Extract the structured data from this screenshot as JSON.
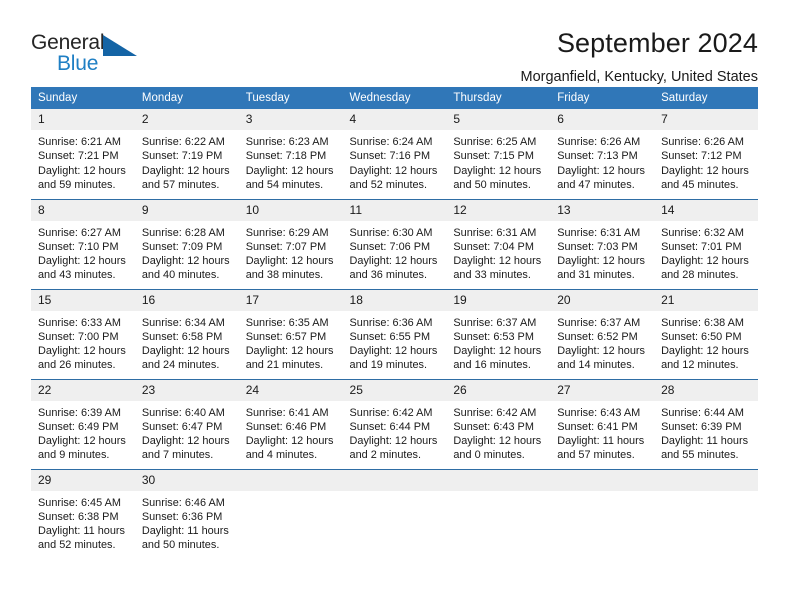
{
  "logo": {
    "line1": "General",
    "line2": "Blue",
    "triangle_color": "#1464a5",
    "blue_text_color": "#1f7fc4"
  },
  "header": {
    "title": "September 2024",
    "subtitle": "Morganfield, Kentucky, United States"
  },
  "theme": {
    "header_band": "#3077b8",
    "row_rule": "#2e6da4",
    "daynum_band": "#efefef"
  },
  "weekday_headers": [
    "Sunday",
    "Monday",
    "Tuesday",
    "Wednesday",
    "Thursday",
    "Friday",
    "Saturday"
  ],
  "weeks": [
    [
      {
        "day": "1",
        "sunrise": "Sunrise: 6:21 AM",
        "sunset": "Sunset: 7:21 PM",
        "daylight1": "Daylight: 12 hours",
        "daylight2": "and 59 minutes."
      },
      {
        "day": "2",
        "sunrise": "Sunrise: 6:22 AM",
        "sunset": "Sunset: 7:19 PM",
        "daylight1": "Daylight: 12 hours",
        "daylight2": "and 57 minutes."
      },
      {
        "day": "3",
        "sunrise": "Sunrise: 6:23 AM",
        "sunset": "Sunset: 7:18 PM",
        "daylight1": "Daylight: 12 hours",
        "daylight2": "and 54 minutes."
      },
      {
        "day": "4",
        "sunrise": "Sunrise: 6:24 AM",
        "sunset": "Sunset: 7:16 PM",
        "daylight1": "Daylight: 12 hours",
        "daylight2": "and 52 minutes."
      },
      {
        "day": "5",
        "sunrise": "Sunrise: 6:25 AM",
        "sunset": "Sunset: 7:15 PM",
        "daylight1": "Daylight: 12 hours",
        "daylight2": "and 50 minutes."
      },
      {
        "day": "6",
        "sunrise": "Sunrise: 6:26 AM",
        "sunset": "Sunset: 7:13 PM",
        "daylight1": "Daylight: 12 hours",
        "daylight2": "and 47 minutes."
      },
      {
        "day": "7",
        "sunrise": "Sunrise: 6:26 AM",
        "sunset": "Sunset: 7:12 PM",
        "daylight1": "Daylight: 12 hours",
        "daylight2": "and 45 minutes."
      }
    ],
    [
      {
        "day": "8",
        "sunrise": "Sunrise: 6:27 AM",
        "sunset": "Sunset: 7:10 PM",
        "daylight1": "Daylight: 12 hours",
        "daylight2": "and 43 minutes."
      },
      {
        "day": "9",
        "sunrise": "Sunrise: 6:28 AM",
        "sunset": "Sunset: 7:09 PM",
        "daylight1": "Daylight: 12 hours",
        "daylight2": "and 40 minutes."
      },
      {
        "day": "10",
        "sunrise": "Sunrise: 6:29 AM",
        "sunset": "Sunset: 7:07 PM",
        "daylight1": "Daylight: 12 hours",
        "daylight2": "and 38 minutes."
      },
      {
        "day": "11",
        "sunrise": "Sunrise: 6:30 AM",
        "sunset": "Sunset: 7:06 PM",
        "daylight1": "Daylight: 12 hours",
        "daylight2": "and 36 minutes."
      },
      {
        "day": "12",
        "sunrise": "Sunrise: 6:31 AM",
        "sunset": "Sunset: 7:04 PM",
        "daylight1": "Daylight: 12 hours",
        "daylight2": "and 33 minutes."
      },
      {
        "day": "13",
        "sunrise": "Sunrise: 6:31 AM",
        "sunset": "Sunset: 7:03 PM",
        "daylight1": "Daylight: 12 hours",
        "daylight2": "and 31 minutes."
      },
      {
        "day": "14",
        "sunrise": "Sunrise: 6:32 AM",
        "sunset": "Sunset: 7:01 PM",
        "daylight1": "Daylight: 12 hours",
        "daylight2": "and 28 minutes."
      }
    ],
    [
      {
        "day": "15",
        "sunrise": "Sunrise: 6:33 AM",
        "sunset": "Sunset: 7:00 PM",
        "daylight1": "Daylight: 12 hours",
        "daylight2": "and 26 minutes."
      },
      {
        "day": "16",
        "sunrise": "Sunrise: 6:34 AM",
        "sunset": "Sunset: 6:58 PM",
        "daylight1": "Daylight: 12 hours",
        "daylight2": "and 24 minutes."
      },
      {
        "day": "17",
        "sunrise": "Sunrise: 6:35 AM",
        "sunset": "Sunset: 6:57 PM",
        "daylight1": "Daylight: 12 hours",
        "daylight2": "and 21 minutes."
      },
      {
        "day": "18",
        "sunrise": "Sunrise: 6:36 AM",
        "sunset": "Sunset: 6:55 PM",
        "daylight1": "Daylight: 12 hours",
        "daylight2": "and 19 minutes."
      },
      {
        "day": "19",
        "sunrise": "Sunrise: 6:37 AM",
        "sunset": "Sunset: 6:53 PM",
        "daylight1": "Daylight: 12 hours",
        "daylight2": "and 16 minutes."
      },
      {
        "day": "20",
        "sunrise": "Sunrise: 6:37 AM",
        "sunset": "Sunset: 6:52 PM",
        "daylight1": "Daylight: 12 hours",
        "daylight2": "and 14 minutes."
      },
      {
        "day": "21",
        "sunrise": "Sunrise: 6:38 AM",
        "sunset": "Sunset: 6:50 PM",
        "daylight1": "Daylight: 12 hours",
        "daylight2": "and 12 minutes."
      }
    ],
    [
      {
        "day": "22",
        "sunrise": "Sunrise: 6:39 AM",
        "sunset": "Sunset: 6:49 PM",
        "daylight1": "Daylight: 12 hours",
        "daylight2": "and 9 minutes."
      },
      {
        "day": "23",
        "sunrise": "Sunrise: 6:40 AM",
        "sunset": "Sunset: 6:47 PM",
        "daylight1": "Daylight: 12 hours",
        "daylight2": "and 7 minutes."
      },
      {
        "day": "24",
        "sunrise": "Sunrise: 6:41 AM",
        "sunset": "Sunset: 6:46 PM",
        "daylight1": "Daylight: 12 hours",
        "daylight2": "and 4 minutes."
      },
      {
        "day": "25",
        "sunrise": "Sunrise: 6:42 AM",
        "sunset": "Sunset: 6:44 PM",
        "daylight1": "Daylight: 12 hours",
        "daylight2": "and 2 minutes."
      },
      {
        "day": "26",
        "sunrise": "Sunrise: 6:42 AM",
        "sunset": "Sunset: 6:43 PM",
        "daylight1": "Daylight: 12 hours",
        "daylight2": "and 0 minutes."
      },
      {
        "day": "27",
        "sunrise": "Sunrise: 6:43 AM",
        "sunset": "Sunset: 6:41 PM",
        "daylight1": "Daylight: 11 hours",
        "daylight2": "and 57 minutes."
      },
      {
        "day": "28",
        "sunrise": "Sunrise: 6:44 AM",
        "sunset": "Sunset: 6:39 PM",
        "daylight1": "Daylight: 11 hours",
        "daylight2": "and 55 minutes."
      }
    ],
    [
      {
        "day": "29",
        "sunrise": "Sunrise: 6:45 AM",
        "sunset": "Sunset: 6:38 PM",
        "daylight1": "Daylight: 11 hours",
        "daylight2": "and 52 minutes."
      },
      {
        "day": "30",
        "sunrise": "Sunrise: 6:46 AM",
        "sunset": "Sunset: 6:36 PM",
        "daylight1": "Daylight: 11 hours",
        "daylight2": "and 50 minutes."
      },
      {
        "day": "",
        "sunrise": "",
        "sunset": "",
        "daylight1": "",
        "daylight2": ""
      },
      {
        "day": "",
        "sunrise": "",
        "sunset": "",
        "daylight1": "",
        "daylight2": ""
      },
      {
        "day": "",
        "sunrise": "",
        "sunset": "",
        "daylight1": "",
        "daylight2": ""
      },
      {
        "day": "",
        "sunrise": "",
        "sunset": "",
        "daylight1": "",
        "daylight2": ""
      },
      {
        "day": "",
        "sunrise": "",
        "sunset": "",
        "daylight1": "",
        "daylight2": ""
      }
    ]
  ]
}
